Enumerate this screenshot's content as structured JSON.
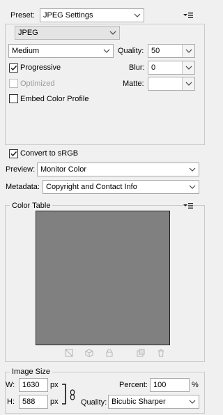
{
  "preset": {
    "label": "Preset:",
    "value": "JPEG Settings"
  },
  "format": {
    "value": "JPEG"
  },
  "quality_preset": {
    "value": "Medium"
  },
  "quality": {
    "label": "Quality:",
    "value": "50"
  },
  "blur": {
    "label": "Blur:",
    "value": "0"
  },
  "matte": {
    "label": "Matte:",
    "value": ""
  },
  "progressive": {
    "label": "Progressive",
    "checked": true
  },
  "optimized": {
    "label": "Optimized",
    "checked": false,
    "enabled": false
  },
  "embed_profile": {
    "label": "Embed Color Profile",
    "checked": false
  },
  "convert_srgb": {
    "label": "Convert to sRGB",
    "checked": true
  },
  "preview": {
    "label": "Preview:",
    "value": "Monitor Color"
  },
  "metadata": {
    "label": "Metadata:",
    "value": "Copyright and Contact Info"
  },
  "color_table": {
    "title": "Color Table",
    "swatch_color": "#808080",
    "icons": [
      "web-shift-icon",
      "cube-icon",
      "lock-icon",
      "new-color-icon",
      "trash-icon"
    ]
  },
  "image_size": {
    "title": "Image Size",
    "w_label": "W:",
    "w_value": "1630",
    "w_unit": "px",
    "h_label": "H:",
    "h_value": "588",
    "h_unit": "px",
    "percent_label": "Percent:",
    "percent_value": "100",
    "percent_unit": "%",
    "quality_label": "Quality:",
    "quality_value": "Bicubic Sharper"
  }
}
